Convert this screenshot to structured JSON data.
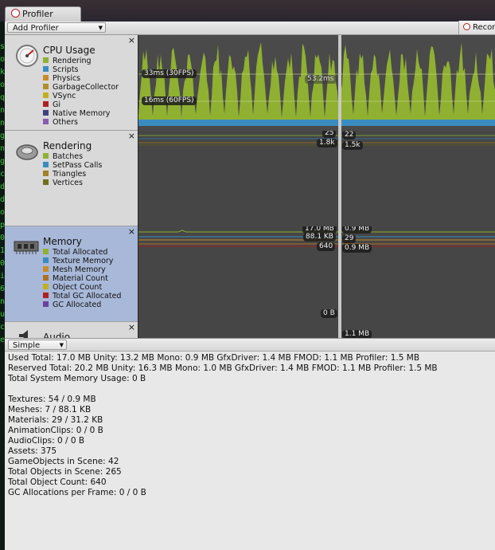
{
  "window": {
    "tab_title": "Profiler",
    "add_profiler_label": "Add Profiler",
    "record_label": "Record"
  },
  "left_strip": {
    "glyphs": [
      "s",
      "o",
      "k",
      "o",
      "q",
      "n",
      "n",
      "g",
      "n",
      "g",
      "c",
      "d",
      "d",
      "o",
      "p",
      "0",
      "1",
      "0",
      "i",
      "6",
      "n",
      "u",
      "c",
      "e"
    ]
  },
  "panels": [
    {
      "name": "CPU Usage",
      "icon": "cpu-usage-icon",
      "close": "×",
      "items": [
        {
          "label": "Rendering",
          "color": "#8fb030"
        },
        {
          "label": "Scripts",
          "color": "#3a8cc0"
        },
        {
          "label": "Physics",
          "color": "#c88c2a"
        },
        {
          "label": "GarbageCollector",
          "color": "#b0902a"
        },
        {
          "label": "VSync",
          "color": "#c0b020"
        },
        {
          "label": "Gi",
          "color": "#b02020"
        },
        {
          "label": "Native Memory",
          "color": "#404080"
        },
        {
          "label": "Others",
          "color": "#8a5ab0"
        }
      ]
    },
    {
      "name": "Rendering",
      "icon": "rendering-icon",
      "close": "×",
      "items": [
        {
          "label": "Batches",
          "color": "#8fb030"
        },
        {
          "label": "SetPass Calls",
          "color": "#3a8cc0"
        },
        {
          "label": "Triangles",
          "color": "#a0802a"
        },
        {
          "label": "Vertices",
          "color": "#707020"
        }
      ]
    },
    {
      "name": "Memory",
      "icon": "memory-icon",
      "close": "×",
      "items": [
        {
          "label": "Total Allocated",
          "color": "#8fb030"
        },
        {
          "label": "Texture Memory",
          "color": "#3a8cc0"
        },
        {
          "label": "Mesh Memory",
          "color": "#c88c2a"
        },
        {
          "label": "Material Count",
          "color": "#b07020"
        },
        {
          "label": "Object Count",
          "color": "#c0b020"
        },
        {
          "label": "Total GC Allocated",
          "color": "#b02020"
        },
        {
          "label": "GC Allocated",
          "color": "#6a40a0"
        }
      ]
    },
    {
      "name": "Audio",
      "icon": "audio-icon",
      "close": "×",
      "items": []
    }
  ],
  "cpu_graph": {
    "fps_30_label": "33ms (30FPS)",
    "fps_60_label": "16ms (60FPS)",
    "cursor_label": "53.2ms",
    "fill_color": "#8fb030",
    "scripts_color": "#3a8cc0"
  },
  "rendering_graph": {
    "left_tags": [
      "25",
      "1.8k"
    ],
    "right_tags": [
      "22",
      "1.5k"
    ]
  },
  "memory_graph": {
    "left_tags": [
      "17.0 MB",
      "88.1 KB",
      "640",
      "0 B"
    ],
    "right_tags": [
      "0.9 MB",
      "29",
      "0.9 MB"
    ]
  },
  "audio_graph": {
    "right_tags": [
      "1.1 MB"
    ]
  },
  "view_mode": "Simple",
  "details_lines": [
    "Used Total: 17.0 MB   Unity: 13.2 MB   Mono: 0.9 MB   GfxDriver: 1.4 MB   FMOD: 1.1 MB   Profiler: 1.5 MB",
    "Reserved Total: 20.2 MB   Unity: 16.3 MB   Mono: 1.0 MB   GfxDriver: 1.4 MB   FMOD: 1.1 MB   Profiler: 1.5 MB",
    "Total System Memory Usage: 0 B",
    "",
    "Textures: 54 / 0.9 MB",
    "Meshes: 7 / 88.1 KB",
    "Materials: 29 / 31.2 KB",
    "AnimationClips: 0 / 0 B",
    "AudioClips: 0 / 0 B",
    "Assets: 375",
    "GameObjects in Scene: 42",
    "Total Objects in Scene: 265",
    "Total Object Count: 640",
    "GC Allocations per Frame: 0 / 0 B"
  ]
}
